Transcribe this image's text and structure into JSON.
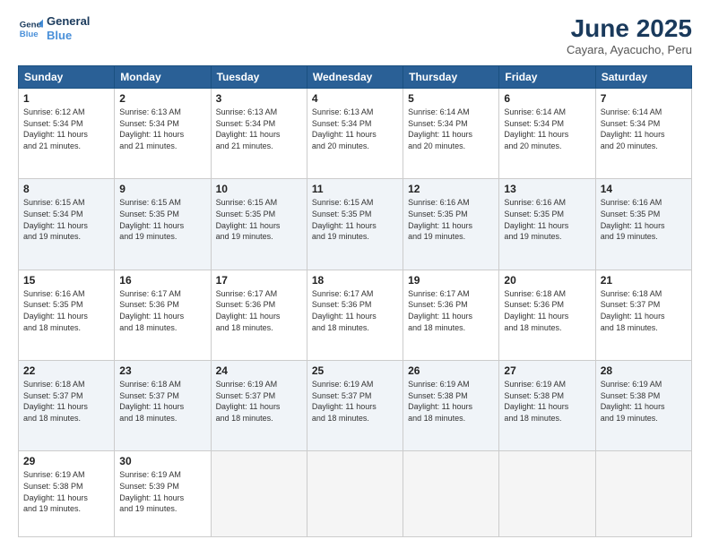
{
  "logo": {
    "line1": "General",
    "line2": "Blue"
  },
  "title": "June 2025",
  "location": "Cayara, Ayacucho, Peru",
  "days_of_week": [
    "Sunday",
    "Monday",
    "Tuesday",
    "Wednesday",
    "Thursday",
    "Friday",
    "Saturday"
  ],
  "weeks": [
    [
      {
        "day": "1",
        "info": "Sunrise: 6:12 AM\nSunset: 5:34 PM\nDaylight: 11 hours\nand 21 minutes."
      },
      {
        "day": "2",
        "info": "Sunrise: 6:13 AM\nSunset: 5:34 PM\nDaylight: 11 hours\nand 21 minutes."
      },
      {
        "day": "3",
        "info": "Sunrise: 6:13 AM\nSunset: 5:34 PM\nDaylight: 11 hours\nand 21 minutes."
      },
      {
        "day": "4",
        "info": "Sunrise: 6:13 AM\nSunset: 5:34 PM\nDaylight: 11 hours\nand 20 minutes."
      },
      {
        "day": "5",
        "info": "Sunrise: 6:14 AM\nSunset: 5:34 PM\nDaylight: 11 hours\nand 20 minutes."
      },
      {
        "day": "6",
        "info": "Sunrise: 6:14 AM\nSunset: 5:34 PM\nDaylight: 11 hours\nand 20 minutes."
      },
      {
        "day": "7",
        "info": "Sunrise: 6:14 AM\nSunset: 5:34 PM\nDaylight: 11 hours\nand 20 minutes."
      }
    ],
    [
      {
        "day": "8",
        "info": "Sunrise: 6:15 AM\nSunset: 5:34 PM\nDaylight: 11 hours\nand 19 minutes."
      },
      {
        "day": "9",
        "info": "Sunrise: 6:15 AM\nSunset: 5:35 PM\nDaylight: 11 hours\nand 19 minutes."
      },
      {
        "day": "10",
        "info": "Sunrise: 6:15 AM\nSunset: 5:35 PM\nDaylight: 11 hours\nand 19 minutes."
      },
      {
        "day": "11",
        "info": "Sunrise: 6:15 AM\nSunset: 5:35 PM\nDaylight: 11 hours\nand 19 minutes."
      },
      {
        "day": "12",
        "info": "Sunrise: 6:16 AM\nSunset: 5:35 PM\nDaylight: 11 hours\nand 19 minutes."
      },
      {
        "day": "13",
        "info": "Sunrise: 6:16 AM\nSunset: 5:35 PM\nDaylight: 11 hours\nand 19 minutes."
      },
      {
        "day": "14",
        "info": "Sunrise: 6:16 AM\nSunset: 5:35 PM\nDaylight: 11 hours\nand 19 minutes."
      }
    ],
    [
      {
        "day": "15",
        "info": "Sunrise: 6:16 AM\nSunset: 5:35 PM\nDaylight: 11 hours\nand 18 minutes."
      },
      {
        "day": "16",
        "info": "Sunrise: 6:17 AM\nSunset: 5:36 PM\nDaylight: 11 hours\nand 18 minutes."
      },
      {
        "day": "17",
        "info": "Sunrise: 6:17 AM\nSunset: 5:36 PM\nDaylight: 11 hours\nand 18 minutes."
      },
      {
        "day": "18",
        "info": "Sunrise: 6:17 AM\nSunset: 5:36 PM\nDaylight: 11 hours\nand 18 minutes."
      },
      {
        "day": "19",
        "info": "Sunrise: 6:17 AM\nSunset: 5:36 PM\nDaylight: 11 hours\nand 18 minutes."
      },
      {
        "day": "20",
        "info": "Sunrise: 6:18 AM\nSunset: 5:36 PM\nDaylight: 11 hours\nand 18 minutes."
      },
      {
        "day": "21",
        "info": "Sunrise: 6:18 AM\nSunset: 5:37 PM\nDaylight: 11 hours\nand 18 minutes."
      }
    ],
    [
      {
        "day": "22",
        "info": "Sunrise: 6:18 AM\nSunset: 5:37 PM\nDaylight: 11 hours\nand 18 minutes."
      },
      {
        "day": "23",
        "info": "Sunrise: 6:18 AM\nSunset: 5:37 PM\nDaylight: 11 hours\nand 18 minutes."
      },
      {
        "day": "24",
        "info": "Sunrise: 6:19 AM\nSunset: 5:37 PM\nDaylight: 11 hours\nand 18 minutes."
      },
      {
        "day": "25",
        "info": "Sunrise: 6:19 AM\nSunset: 5:37 PM\nDaylight: 11 hours\nand 18 minutes."
      },
      {
        "day": "26",
        "info": "Sunrise: 6:19 AM\nSunset: 5:38 PM\nDaylight: 11 hours\nand 18 minutes."
      },
      {
        "day": "27",
        "info": "Sunrise: 6:19 AM\nSunset: 5:38 PM\nDaylight: 11 hours\nand 18 minutes."
      },
      {
        "day": "28",
        "info": "Sunrise: 6:19 AM\nSunset: 5:38 PM\nDaylight: 11 hours\nand 19 minutes."
      }
    ],
    [
      {
        "day": "29",
        "info": "Sunrise: 6:19 AM\nSunset: 5:38 PM\nDaylight: 11 hours\nand 19 minutes."
      },
      {
        "day": "30",
        "info": "Sunrise: 6:19 AM\nSunset: 5:39 PM\nDaylight: 11 hours\nand 19 minutes."
      },
      {
        "day": "",
        "info": ""
      },
      {
        "day": "",
        "info": ""
      },
      {
        "day": "",
        "info": ""
      },
      {
        "day": "",
        "info": ""
      },
      {
        "day": "",
        "info": ""
      }
    ]
  ]
}
